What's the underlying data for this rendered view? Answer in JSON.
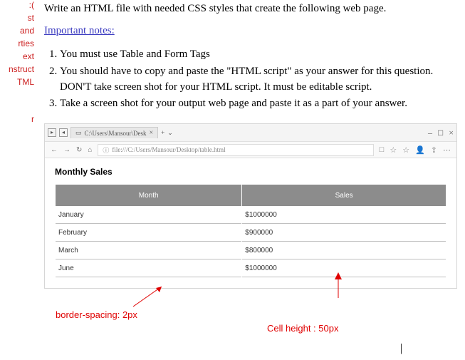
{
  "sidebar": {
    "items": [
      {
        "label": "):"
      },
      {
        "label": "st"
      },
      {
        "label": "and"
      },
      {
        "label": "rties"
      },
      {
        "label": "ext"
      },
      {
        "label": "nstruct"
      },
      {
        "label": "TML"
      },
      {
        "label": "r"
      }
    ]
  },
  "intro": "Write an HTML file with needed CSS styles that create the following web page.",
  "notes_title": "Important notes:",
  "notes": [
    "You must use Table and Form Tags",
    "You should have to copy and paste the \"HTML script\" as your answer for this question. DON'T take screen shot for your HTML script. It must be editable script.",
    "Take a screen shot for your output web page and paste it as a part of your answer."
  ],
  "browser": {
    "tab_title": "C:\\Users\\Mansour\\Desk",
    "url": "file:///C:/Users/Mansour/Desktop/table.html",
    "window_controls": {
      "min": "–",
      "max": "□",
      "close": "×"
    },
    "addr_right": {
      "bookmark": "□",
      "star": "☆",
      "star2": "☆",
      "person": "👤",
      "share": "⇪",
      "more": "⋯"
    }
  },
  "page": {
    "title": "Monthly Sales",
    "headers": [
      "Month",
      "Sales"
    ],
    "rows": [
      {
        "month": "January",
        "sales": "$1000000"
      },
      {
        "month": "February",
        "sales": "$900000"
      },
      {
        "month": "March",
        "sales": "$800000"
      },
      {
        "month": "June",
        "sales": "$1000000"
      }
    ]
  },
  "annotations": {
    "border_spacing": "border-spacing: 2px",
    "cell_height": "Cell height : 50px"
  },
  "chart_data": {
    "type": "table",
    "title": "Monthly Sales",
    "categories": [
      "January",
      "February",
      "March",
      "June"
    ],
    "values": [
      1000000,
      900000,
      800000,
      1000000
    ],
    "xlabel": "Month",
    "ylabel": "Sales"
  }
}
